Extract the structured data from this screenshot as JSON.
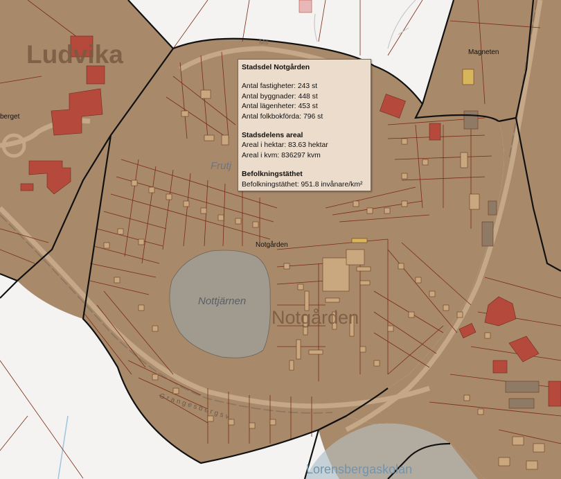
{
  "map": {
    "colors": {
      "background": "#f2f2f0",
      "district_fill": "#a88b6a",
      "parcel_line": "#7a2a14",
      "district_border": "#111111",
      "building": "#c9a77f",
      "building_red": "#b54a3c",
      "water": "#a09a8f",
      "water_outside": "#d6e8f1"
    },
    "labels": {
      "city": "Ludvika",
      "district": "Notgården",
      "district_point": "Notgården",
      "lake": "Nottjärnen",
      "magneten": "Magneten",
      "frutj": "Frutj",
      "berget": "berget",
      "ms": "Ms",
      "road": "Grangesbergsv.",
      "lorensberga": "Lorensbergaskolan"
    }
  },
  "popup": {
    "title": "Stadsdel Notgården",
    "fastigheter": "Antal fastigheter: 243 st",
    "byggnader": "Antal byggnader: 448 st",
    "lagenheter": "Antal lägenheter: 453 st",
    "folkbokforda": "Antal folkbokförda: 796 st",
    "areal_heading": "Stadsdelens areal",
    "hektar": "Areal i hektar: 83.63 hektar",
    "kvm": "Areal i kvm: 836297 kvm",
    "befolkning_heading": "Befolkningstäthet",
    "tathet": "Befolkningstäthet: 951.8 invånare/km²"
  }
}
